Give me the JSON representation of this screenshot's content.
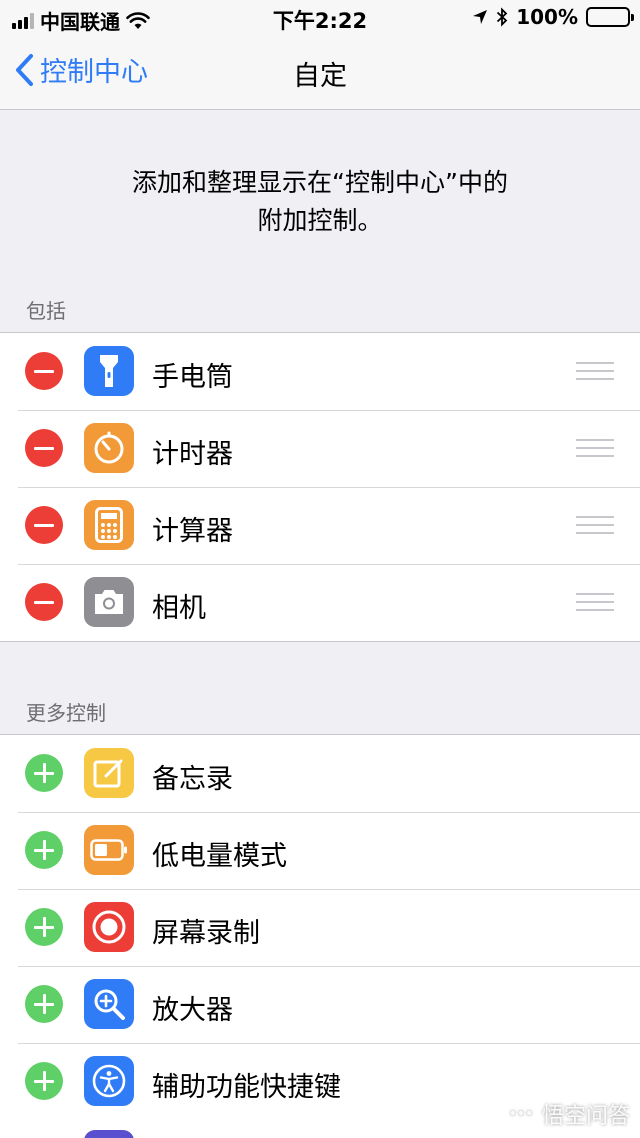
{
  "status_bar": {
    "carrier": "中国联通",
    "time": "下午2:22",
    "battery_percent": "100%"
  },
  "nav": {
    "back_label": "控制中心",
    "title": "自定"
  },
  "description": {
    "line1": "添加和整理显示在“控制中心”中的",
    "line2": "附加控制。"
  },
  "included": {
    "header": "包括",
    "items": [
      {
        "label": "手电筒",
        "icon": "flashlight-icon",
        "color": "#2f7cf6"
      },
      {
        "label": "计时器",
        "icon": "timer-icon",
        "color": "#f29a38"
      },
      {
        "label": "计算器",
        "icon": "calculator-icon",
        "color": "#f29a38"
      },
      {
        "label": "相机",
        "icon": "camera-icon",
        "color": "#8e8e93"
      }
    ]
  },
  "more": {
    "header": "更多控制",
    "items": [
      {
        "label": "备忘录",
        "icon": "notes-icon",
        "color": "#f7c844"
      },
      {
        "label": "低电量模式",
        "icon": "low-power-icon",
        "color": "#f29a38"
      },
      {
        "label": "屏幕录制",
        "icon": "screen-record-icon",
        "color": "#ec3d36"
      },
      {
        "label": "放大器",
        "icon": "magnifier-icon",
        "color": "#2f7cf6"
      },
      {
        "label": "辅助功能快捷键",
        "icon": "accessibility-icon",
        "color": "#2f7cf6"
      }
    ]
  },
  "watermark": {
    "text": "悟空问答"
  }
}
